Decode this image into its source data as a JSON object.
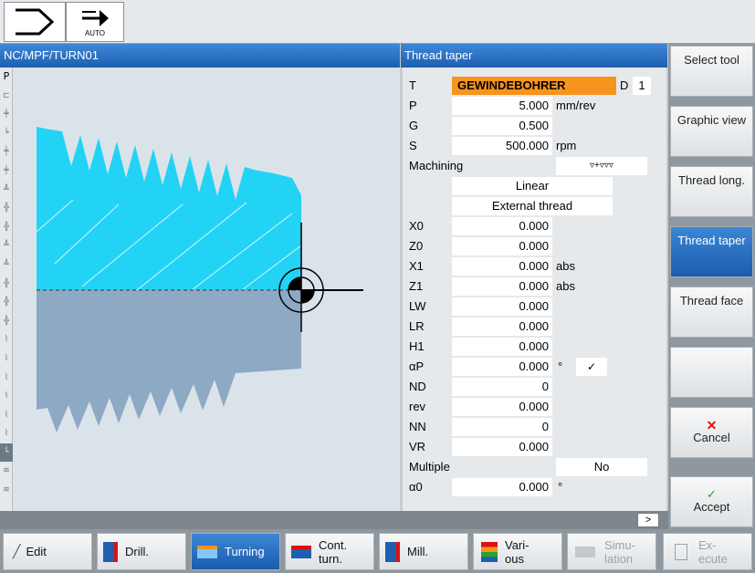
{
  "topbar": {
    "mode_label": "AUTO"
  },
  "header": {
    "left_title": "NC/MPF/TURN01",
    "right_title": "Thread taper"
  },
  "icon_strip": [
    "P"
  ],
  "form": {
    "t_label": "T",
    "t_value": "GEWINDEBOHRER",
    "d_label": "D",
    "d_value": "1",
    "p_label": "P",
    "p_value": "5.000",
    "p_unit": "mm/rev",
    "g_label": "G",
    "g_value": "0.500",
    "s_label": "S",
    "s_value": "500.000",
    "s_unit": "rpm",
    "machining_label": "Machining",
    "machining_value": "▿+▿▿▿",
    "linear_value": "Linear",
    "thread_type_value": "External thread",
    "x0_label": "X0",
    "x0_value": "0.000",
    "z0_label": "Z0",
    "z0_value": "0.000",
    "x1_label": "X1",
    "x1_value": "0.000",
    "x1_unit": "abs",
    "z1_label": "Z1",
    "z1_value": "0.000",
    "z1_unit": "abs",
    "lw_label": "LW",
    "lw_value": "0.000",
    "lr_label": "LR",
    "lr_value": "0.000",
    "h1_label": "H1",
    "h1_value": "0.000",
    "ap_label": "αP",
    "ap_value": "0.000",
    "ap_unit": "°",
    "nd_label": "ND",
    "nd_value": "0",
    "rev_label": "rev",
    "rev_value": "0.000",
    "nn_label": "NN",
    "nn_value": "0",
    "vr_label": "VR",
    "vr_value": "0.000",
    "multiple_label": "Multiple",
    "multiple_value": "No",
    "a0_label": "α0",
    "a0_value": "0.000",
    "a0_unit": "°"
  },
  "scroll_next": ">",
  "softkeys": {
    "select_tool": "Select tool",
    "graphic_view": "Graphic view",
    "thread_long": "Thread long.",
    "thread_taper": "Thread taper",
    "thread_face": "Thread face",
    "cancel": "Cancel",
    "accept": "Accept"
  },
  "hkeys": {
    "edit": "Edit",
    "drill": "Drill.",
    "turning": "Turning",
    "cont_turn_1": "Cont.",
    "cont_turn_2": "turn.",
    "mill": "Mill.",
    "various_1": "Vari-",
    "various_2": "ous",
    "simulation_1": "Simu-",
    "simulation_2": "lation",
    "execute_1": "Ex-",
    "execute_2": "ecute"
  },
  "colors": {
    "accent_blue": "#1d5fb0",
    "thread_cyan": "#22d3f5",
    "workpiece_gray": "#8ea9c4",
    "tool_orange": "#f7941d",
    "cancel_red": "#e01010",
    "accept_green": "#2ca02c"
  }
}
